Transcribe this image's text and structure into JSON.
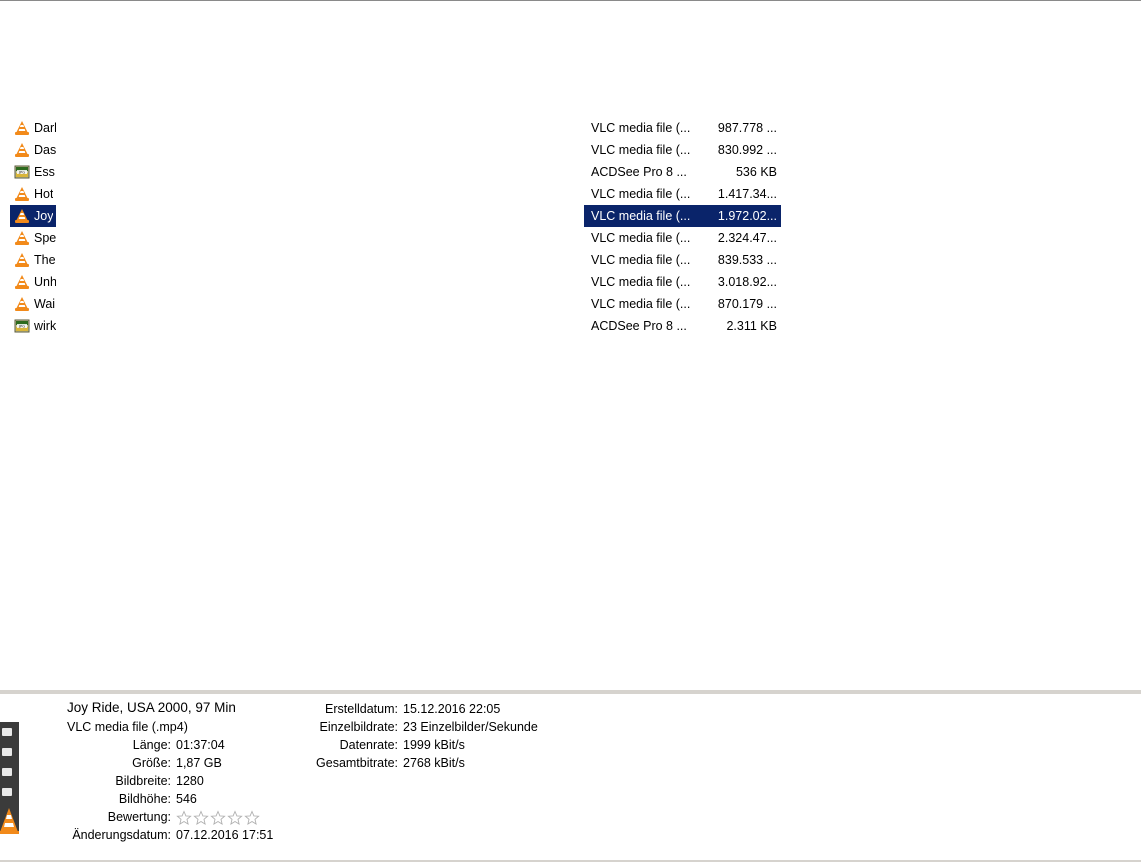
{
  "file_list": {
    "rows": [
      {
        "name": "Darl",
        "icon": "vlc-icon",
        "type": "VLC media file (...",
        "size": "987.778 ..."
      },
      {
        "name": "Das",
        "icon": "vlc-icon",
        "type": "VLC media file (...",
        "size": "830.992 ..."
      },
      {
        "name": "Ess",
        "icon": "jpg-icon",
        "type": "ACDSee Pro 8 ...",
        "size": "536 KB"
      },
      {
        "name": "Hot",
        "icon": "vlc-icon",
        "type": "VLC media file (...",
        "size": "1.417.34..."
      },
      {
        "name": "Joy",
        "icon": "vlc-icon",
        "type": "VLC media file (...",
        "size": "1.972.02...",
        "selected": true
      },
      {
        "name": "Spe",
        "icon": "vlc-icon",
        "type": "VLC media file (...",
        "size": "2.324.47..."
      },
      {
        "name": "The",
        "icon": "vlc-icon",
        "type": "VLC media file (...",
        "size": "839.533 ..."
      },
      {
        "name": "Unh",
        "icon": "vlc-icon",
        "type": "VLC media file (...",
        "size": "3.018.92..."
      },
      {
        "name": "Wai",
        "icon": "vlc-icon",
        "type": "VLC media file (...",
        "size": "870.179 ..."
      },
      {
        "name": "wirk",
        "icon": "jpg-icon",
        "type": "ACDSee Pro 8 ...",
        "size": "2.311 KB"
      }
    ]
  },
  "details": {
    "title": "Joy Ride, USA 2000, 97 Min",
    "type": "VLC media file (.mp4)",
    "length_label": "Länge:",
    "length": "01:37:04",
    "size_label": "Größe:",
    "size": "1,87 GB",
    "width_label": "Bildbreite:",
    "width": "1280",
    "height_label": "Bildhöhe:",
    "height": "546",
    "rating_label": "Bewertung:",
    "rating": 0,
    "rating_max": 5,
    "modified_label": "Änderungsdatum:",
    "modified": "07.12.2016 17:51",
    "created_label": "Erstelldatum:",
    "created": "15.12.2016 22:05",
    "framerate_label": "Einzelbildrate:",
    "framerate": "23 Einzelbilder/Sekunde",
    "datarate_label": "Datenrate:",
    "datarate": "1999 kBit/s",
    "totalbitrate_label": "Gesamtbitrate:",
    "totalbitrate": "2768 kBit/s"
  },
  "colors": {
    "selection": "#0a246a",
    "vlc_orange": "#f28a1a",
    "pane_border": "#d6d3ce"
  }
}
